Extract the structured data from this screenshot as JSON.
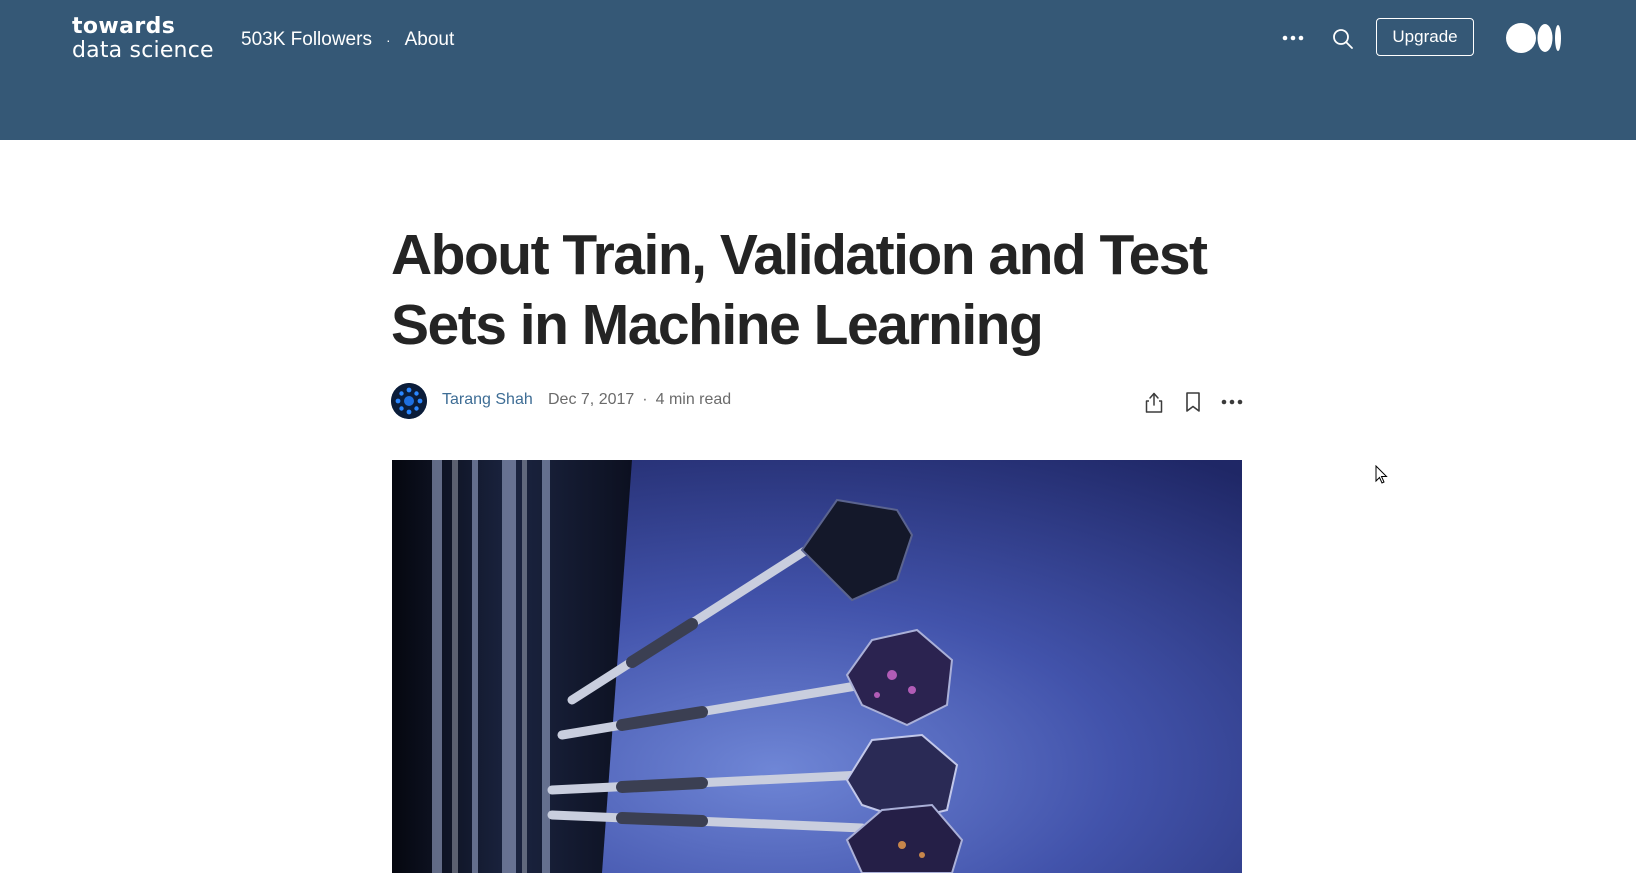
{
  "header": {
    "logo_line1": "towards",
    "logo_line2": "data science",
    "followers": "503K Followers",
    "separator": "·",
    "about": "About",
    "more_icon": "more-dots-icon",
    "search_icon": "search-icon",
    "upgrade_label": "Upgrade",
    "medium_logo": "medium-logo-icon"
  },
  "article": {
    "title": "About Train, Validation and Test Sets in Machine Learning",
    "author": "Tarang Shah",
    "date": "Dec 7, 2017",
    "separator": "·",
    "read_time": "4 min read",
    "actions": {
      "share_icon": "share-icon",
      "bookmark_icon": "bookmark-icon",
      "more_icon": "more-dots-icon"
    },
    "hero_image": "darts-in-dartboard-image"
  },
  "colors": {
    "header_bg": "#355876",
    "title": "#242424",
    "author_link": "#3e6d95",
    "meta": "#6b6b6b"
  }
}
